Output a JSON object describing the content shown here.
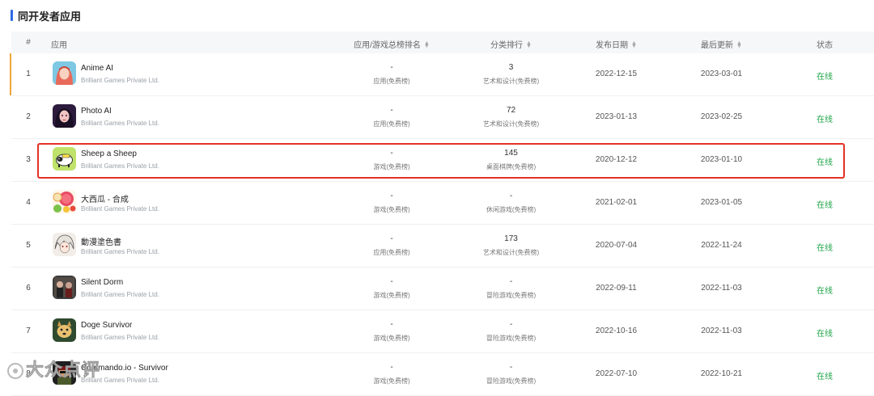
{
  "section": {
    "title": "同开发者应用"
  },
  "table": {
    "headers": {
      "index": "#",
      "app": "应用",
      "rank": "应用/游戏总榜排名",
      "category": "分类排行",
      "release": "发布日期",
      "update": "最后更新",
      "status": "状态"
    },
    "rows": [
      {
        "index": "1",
        "name": "Anime AI",
        "developer": "Brilliant Games Private Ltd.",
        "rank": "-",
        "rank_list": "应用(免费榜)",
        "cat_rank": "3",
        "cat_list": "艺术和设计(免费榜)",
        "release": "2022-12-15",
        "update": "2023-03-01",
        "status": "在线",
        "icon": "anime-girl-icon"
      },
      {
        "index": "2",
        "name": "Photo AI",
        "developer": "Brilliant Games Private Ltd.",
        "rank": "-",
        "rank_list": "应用(免费榜)",
        "cat_rank": "72",
        "cat_list": "艺术和设计(免费榜)",
        "release": "2023-01-13",
        "update": "2023-02-25",
        "status": "在线",
        "icon": "portrait-girl-icon"
      },
      {
        "index": "3",
        "name": "Sheep a Sheep",
        "developer": "Brilliant Games Private Ltd.",
        "rank": "-",
        "rank_list": "游戏(免费榜)",
        "cat_rank": "145",
        "cat_list": "桌面棋牌(免费榜)",
        "release": "2020-12-12",
        "update": "2023-01-10",
        "status": "在线",
        "icon": "sheep-icon"
      },
      {
        "index": "4",
        "name": "大西瓜 - 合成",
        "developer": "Brilliant Games Private Ltd.",
        "rank": "-",
        "rank_list": "游戏(免费榜)",
        "cat_rank": "-",
        "cat_list": "休闲游戏(免费榜)",
        "release": "2021-02-01",
        "update": "2023-01-05",
        "status": "在线",
        "icon": "watermelon-icon"
      },
      {
        "index": "5",
        "name": "動漫塗色書",
        "developer": "Brilliant Games Private Ltd.",
        "rank": "-",
        "rank_list": "应用(免费榜)",
        "cat_rank": "173",
        "cat_list": "艺术和设计(免费榜)",
        "release": "2020-07-04",
        "update": "2022-11-24",
        "status": "在线",
        "icon": "anime-boy-icon"
      },
      {
        "index": "6",
        "name": "Silent Dorm",
        "developer": "Brilliant Games Private Ltd.",
        "rank": "-",
        "rank_list": "游戏(免费榜)",
        "cat_rank": "-",
        "cat_list": "冒险游戏(免费榜)",
        "release": "2022-09-11",
        "update": "2022-11-03",
        "status": "在线",
        "icon": "dorm-icon"
      },
      {
        "index": "7",
        "name": "Doge Survivor",
        "developer": "Brilliant Games Private Ltd.",
        "rank": "-",
        "rank_list": "游戏(免费榜)",
        "cat_rank": "-",
        "cat_list": "冒险游戏(免费榜)",
        "release": "2022-10-16",
        "update": "2022-11-03",
        "status": "在线",
        "icon": "doge-icon"
      },
      {
        "index": "8",
        "name": "Commando.io - Survivor",
        "developer": "Brilliant Games Private Ltd.",
        "rank": "-",
        "rank_list": "游戏(免费榜)",
        "cat_rank": "-",
        "cat_list": "冒险游戏(免费榜)",
        "release": "2022-07-10",
        "update": "2022-10-21",
        "status": "在线",
        "icon": "commando-icon"
      }
    ]
  },
  "watermark": {
    "text": "大众点评"
  },
  "colors": {
    "accent": "#2e6be6",
    "online": "#21a64a",
    "highlight": "#e53126",
    "active": "#f0a53a"
  }
}
